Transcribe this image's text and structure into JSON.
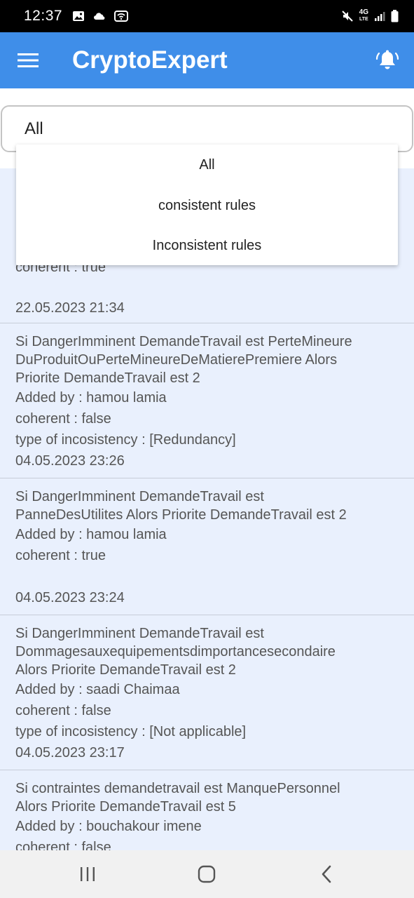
{
  "status_bar": {
    "time": "12:37",
    "network_label_top": "4G",
    "network_label_bottom": "LTE",
    "icons": [
      "image-icon",
      "cloud-icon",
      "wifi-hotspot-icon",
      "mute-icon",
      "signal-icon",
      "battery-icon"
    ]
  },
  "app_bar": {
    "title": "CryptoExpert",
    "menu_icon": "hamburger-menu-icon",
    "notification_icon": "bell-ringing-icon",
    "color": "#3f8ee9"
  },
  "filter": {
    "selected": "All",
    "options": [
      "All",
      "consistent rules",
      "Inconsistent rules"
    ]
  },
  "rules": [
    {
      "hidden_partial": true,
      "coherent": "coherent : true",
      "date": "22.05.2023 21:34"
    },
    {
      "text_lines": [
        "Si DangerImminent DemandeTravail est PerteMineure",
        "DuProduitOuPerteMineureDeMatierePremiere Alors",
        "Priorite DemandeTravail est 2"
      ],
      "added_by": "Added by : hamou lamia",
      "coherent": "coherent : false",
      "inconsistency": "type of incosistency : [Redundancy]",
      "date": "04.05.2023 23:26"
    },
    {
      "text_lines": [
        "Si DangerImminent DemandeTravail est",
        "PanneDesUtilites Alors Priorite DemandeTravail est 2"
      ],
      "added_by": "Added by : hamou lamia",
      "coherent": "coherent : true",
      "date": "04.05.2023 23:24"
    },
    {
      "text_lines": [
        "Si DangerImminent DemandeTravail est",
        "Dommagesauxequipementsdimportancesecondaire",
        "Alors Priorite DemandeTravail est 2"
      ],
      "added_by": "Added by : saadi Chaimaa",
      "coherent": "coherent : false",
      "inconsistency": "type of incosistency : [Not applicable]",
      "date": "04.05.2023 23:17"
    },
    {
      "text_lines": [
        "Si contraintes demandetravail est ManquePersonnel",
        "Alors Priorite DemandeTravail est 5"
      ],
      "added_by": "Added by : bouchakour imene",
      "coherent": "coherent : false"
    }
  ],
  "nav_bar": {
    "icons": [
      "recent-apps-icon",
      "home-icon",
      "back-icon"
    ]
  }
}
